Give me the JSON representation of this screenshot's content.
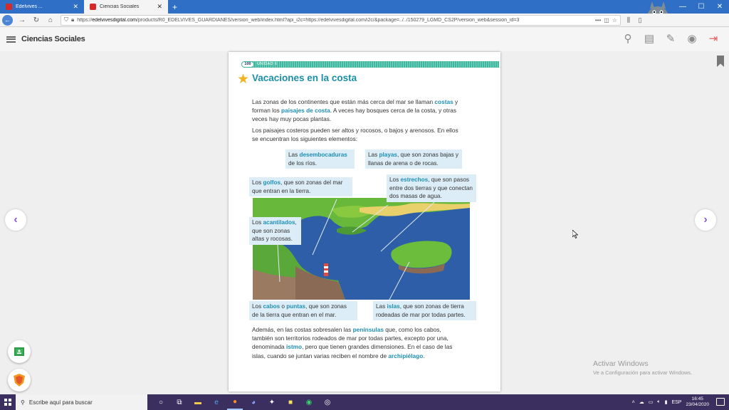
{
  "browser": {
    "tabs": [
      {
        "label": "Edelvives ...",
        "active": false
      },
      {
        "label": "Ciencias Sociales",
        "active": true
      }
    ],
    "new_tab": "+",
    "url_prefix": "https://",
    "url_domain": "edelvivesdigital.com",
    "url_rest": "/products/R0_EDELVIVES_GUARDIANES/version_web/index.html?api_i2c=https://edelvivesdigital.com/i2c/&package=../../150279_LGMD_CS2P/version_web&session_id=3",
    "more": "•••"
  },
  "app": {
    "title": "Ciencias Sociales"
  },
  "page": {
    "number": "100",
    "unit": "UNIDAD 6",
    "title": "Vacaciones en la costa",
    "p1": {
      "a": "Las zonas de los continentes que están más cerca del mar se llaman ",
      "kw1": "costas",
      "b": " y forman los ",
      "kw2": "paisajes de costa",
      "c": ". A veces hay bosques cerca de la costa, y otras veces hay muy pocas plantas."
    },
    "p2": "Los paisajes costeros pueden ser altos y rocosos, o bajos y arenosos. En ellos se encuentran los siguientes elementos:",
    "callouts": {
      "desembocaduras": {
        "a": "Las ",
        "kw": "desembocaduras",
        "b": " de los ríos."
      },
      "playas": {
        "a": "Las ",
        "kw": "playas",
        "b": ", que son zonas bajas y llanas de arena o de rocas."
      },
      "golfos": {
        "a": "Los ",
        "kw": "golfos",
        "b": ", que son zonas del mar que entran en la tierra."
      },
      "estrechos": {
        "a": "Los ",
        "kw": "estrechos",
        "b": ", que son pasos entre dos tierras y que conectan dos masas de agua."
      },
      "acantilados": {
        "a": "Los ",
        "kw": "acantilados",
        "b": ", que son zonas altas y rocosas."
      },
      "cabos": {
        "a": "Los ",
        "kw1": "cabos",
        "mid": " o ",
        "kw2": "puntas",
        "b": ", que son zonas de la tierra que entran en el mar."
      },
      "islas": {
        "a": "Las ",
        "kw": "islas",
        "b": ", que son zonas de tierra rodeadas de mar por todas partes."
      }
    },
    "p3": {
      "a": "Además, en las costas sobresalen las ",
      "kw1": "penínsulas",
      "b": " que, como los cabos, también son territorios rodeados de mar por todas partes, excepto por una, denominada ",
      "kw2": "istmo",
      "c": ", pero que tienen grandes dimensiones. En el caso de las islas, cuando se juntan varias reciben el nombre de ",
      "kw3": "archipiélago",
      "d": "."
    }
  },
  "nav": {
    "prev": "‹",
    "next": "›"
  },
  "watermark": {
    "line1": "Activar Windows",
    "line2": "Ve a Configuración para activar Windows."
  },
  "taskbar": {
    "search_placeholder": "Escribe aquí para buscar",
    "lang": "ESP",
    "time": "16:45",
    "date": "23/04/2020"
  },
  "colors": {
    "accent": "#1a8fa6",
    "keyword": "#1f8fb3",
    "callout_bg": "#dcedf7",
    "taskbar": "#3a2f5e"
  }
}
